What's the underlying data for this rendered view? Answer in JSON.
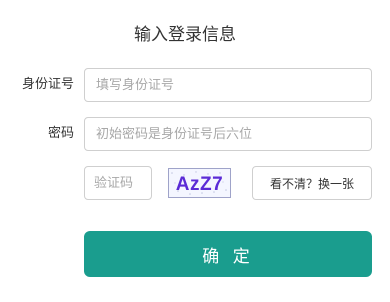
{
  "form": {
    "title": "输入登录信息",
    "id_label": "身份证号",
    "id_placeholder": "填写身份证号",
    "password_label": "密码",
    "password_placeholder": "初始密码是身份证号后六位",
    "captcha_placeholder": "验证码",
    "captcha_text": "AzZ7",
    "refresh_label": "看不清？换一张",
    "submit_label": "确 定"
  },
  "colors": {
    "accent": "#1a9d8e",
    "captcha_text": "#5b2bd6",
    "input_border": "#cfcfcf"
  }
}
